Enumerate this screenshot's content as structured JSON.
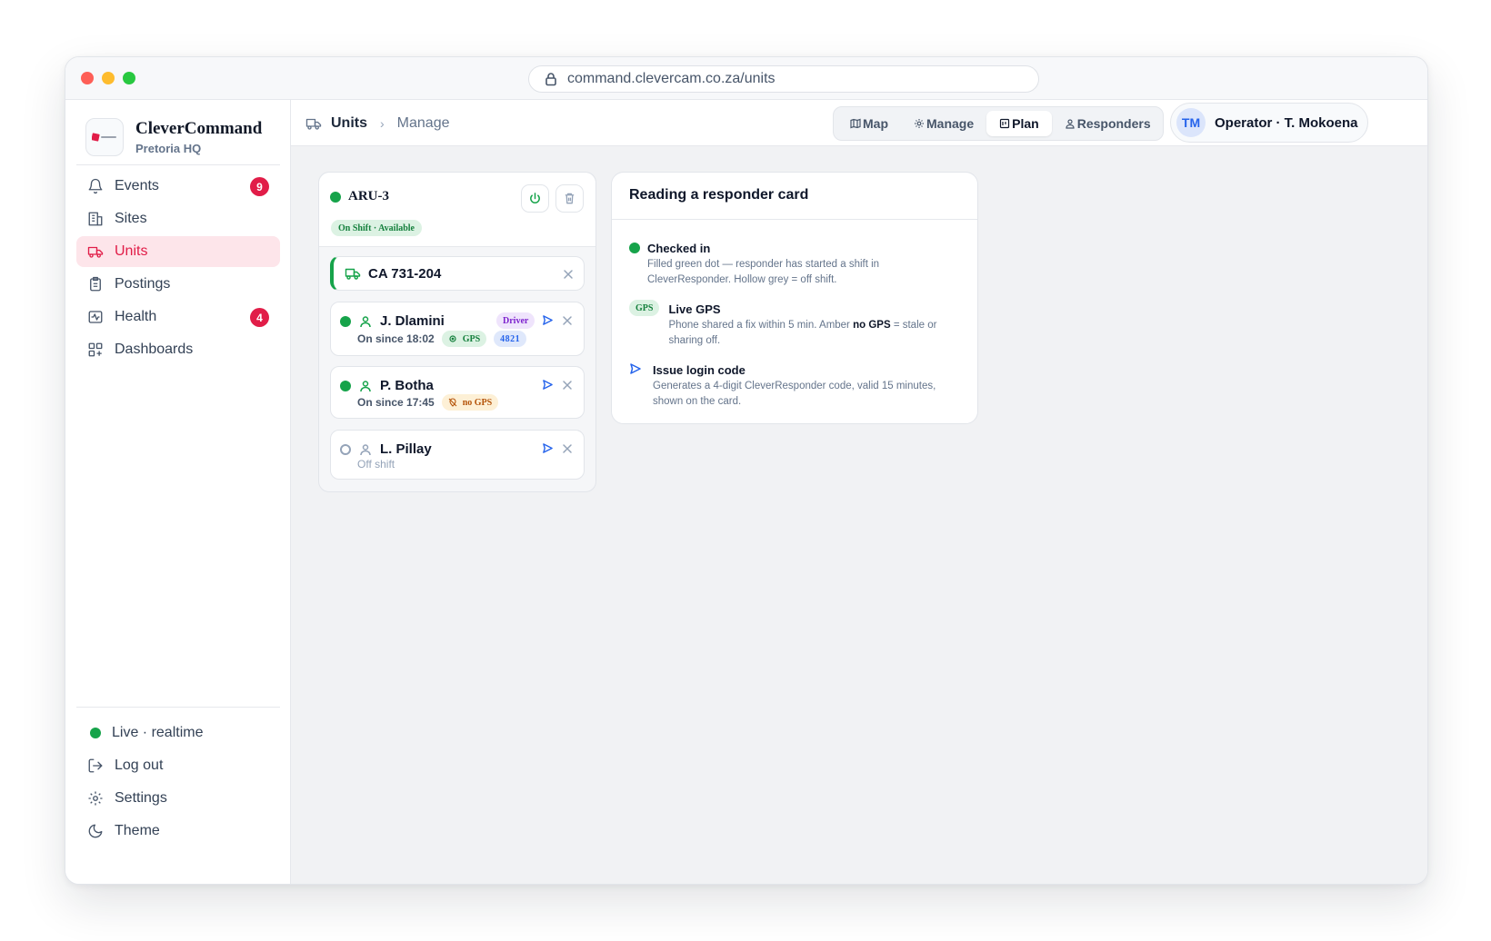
{
  "browser": {
    "url": "command.clevercam.co.za/units"
  },
  "brand": {
    "name": "CleverCommand",
    "location": "Pretoria HQ"
  },
  "sidebar": {
    "items": [
      {
        "label": "Events",
        "icon": "bell-icon",
        "badge": "9"
      },
      {
        "label": "Sites",
        "icon": "building-icon"
      },
      {
        "label": "Units",
        "icon": "truck-icon",
        "active": true
      },
      {
        "label": "Postings",
        "icon": "clipboard-icon"
      },
      {
        "label": "Health",
        "icon": "pulse-icon",
        "badge": "4"
      },
      {
        "label": "Dashboards",
        "icon": "grid-icon"
      }
    ],
    "bottom": {
      "live": "Live · realtime",
      "logout": "Log out",
      "settings": "Settings",
      "theme": "Theme"
    }
  },
  "topbar": {
    "breadcrumb": [
      "Units",
      "Manage"
    ],
    "tabs": [
      {
        "label": "Map",
        "icon": "map-icon"
      },
      {
        "label": "Manage",
        "icon": "gear-icon"
      },
      {
        "label": "Plan",
        "icon": "calendar-icon",
        "active": true
      },
      {
        "label": "Responders",
        "icon": "person-icon"
      }
    ],
    "operator": {
      "initials": "TM",
      "label": "Operator · T. Mokoena"
    }
  },
  "unit": {
    "name": "ARU-3",
    "status": "On Shift · Available",
    "vehicle": "CA 731-204",
    "responders": [
      {
        "name": "J. Dlamini",
        "role": "Driver",
        "since": "On since 18:02",
        "gps": "GPS",
        "code": "4821",
        "checked_in": true
      },
      {
        "name": "P. Botha",
        "since": "On since 17:45",
        "gps": "no GPS",
        "checked_in": true
      },
      {
        "name": "L. Pillay",
        "since": "Off shift",
        "checked_in": false
      }
    ]
  },
  "help": {
    "title": "Reading a responder card",
    "items": [
      {
        "title": "Checked in",
        "desc": "Filled green dot — responder has started a shift in CleverResponder. Hollow grey = off shift."
      },
      {
        "tag": "GPS",
        "title": "Live GPS",
        "desc_pre": "Phone shared a fix within 5 min. Amber ",
        "desc_bold": "no GPS",
        "desc_post": " = stale or sharing off."
      },
      {
        "title": "Issue login code",
        "desc": "Generates a 4-digit CleverResponder code, valid 15 minutes, shown on the card."
      }
    ]
  },
  "colors": {
    "accent": "#e11d48",
    "online": "#16a34a",
    "link": "#2563eb",
    "background": "#f1f2f4"
  }
}
